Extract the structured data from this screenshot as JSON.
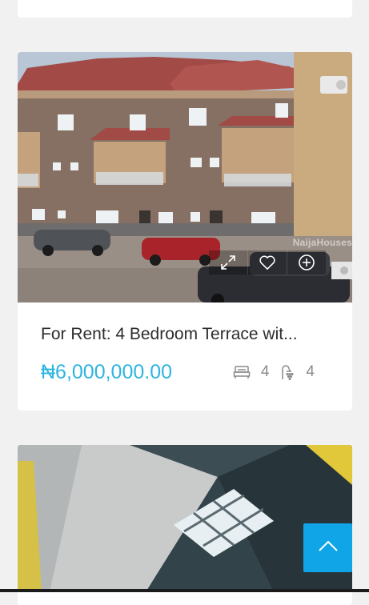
{
  "listing": {
    "title": "For Rent: 4 Bedroom Terrace wit...",
    "price": "₦6,000,000.00",
    "bedrooms": "4",
    "bathrooms": "4",
    "watermark": "NaijaHouses"
  },
  "icons": {
    "expand": "expand-icon",
    "favorite": "heart-icon",
    "compare": "plus-circle-icon",
    "bed": "bed-icon",
    "bath": "shower-icon",
    "scroll_top": "chevron-up-icon"
  },
  "colors": {
    "price": "#2db5e0",
    "scroll_top_bg": "#0fa5e6",
    "page_bg": "#f1f1f1"
  }
}
